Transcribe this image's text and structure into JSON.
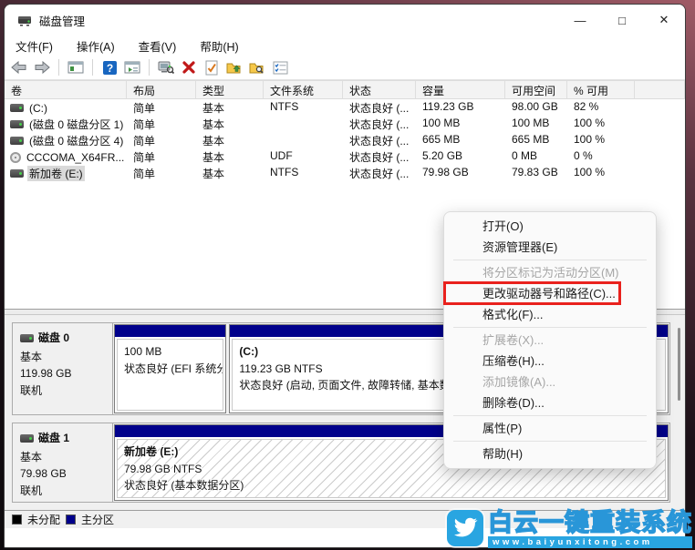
{
  "window": {
    "title": "磁盘管理",
    "controls": {
      "minimize": "—",
      "maximize": "□",
      "close": "✕"
    }
  },
  "menu_bar": {
    "file": "文件(F)",
    "action": "操作(A)",
    "view": "查看(V)",
    "help": "帮助(H)"
  },
  "toolbar": {
    "icon_names": [
      "back-arrow-icon",
      "forward-arrow-icon",
      "console-window-icon",
      "help-icon",
      "action-pane-icon",
      "computer-search-icon",
      "delete-red-x-icon",
      "check-document-icon",
      "folder-up-icon",
      "folder-search-icon",
      "checklist-icon"
    ]
  },
  "volume_table": {
    "columns": [
      "卷",
      "布局",
      "类型",
      "文件系统",
      "状态",
      "容量",
      "可用空间",
      "% 可用"
    ],
    "rows": [
      {
        "icon": "disk",
        "name": "(C:)",
        "layout": "简单",
        "type": "基本",
        "fs": "NTFS",
        "status": "状态良好 (...",
        "capacity": "119.23 GB",
        "free": "98.00 GB",
        "pct": "82 %"
      },
      {
        "icon": "disk",
        "name": "(磁盘 0 磁盘分区 1)",
        "layout": "简单",
        "type": "基本",
        "fs": "",
        "status": "状态良好 (...",
        "capacity": "100 MB",
        "free": "100 MB",
        "pct": "100 %"
      },
      {
        "icon": "disk",
        "name": "(磁盘 0 磁盘分区 4)",
        "layout": "简单",
        "type": "基本",
        "fs": "",
        "status": "状态良好 (...",
        "capacity": "665 MB",
        "free": "665 MB",
        "pct": "100 %"
      },
      {
        "icon": "cd",
        "name": "CCCOMA_X64FR...",
        "layout": "简单",
        "type": "基本",
        "fs": "UDF",
        "status": "状态良好 (...",
        "capacity": "5.20 GB",
        "free": "0 MB",
        "pct": "0 %"
      },
      {
        "icon": "disk",
        "name": "新加卷 (E:)",
        "layout": "简单",
        "type": "基本",
        "fs": "NTFS",
        "status": "状态良好 (...",
        "capacity": "79.98 GB",
        "free": "79.83 GB",
        "pct": "100 %",
        "selected": true
      }
    ]
  },
  "disks": [
    {
      "label": "磁盘 0",
      "type": "基本",
      "size": "119.98 GB",
      "status": "联机",
      "partitions": [
        {
          "name": "",
          "size_line": "100 MB",
          "status_line": "状态良好 (EFI 系统分"
        },
        {
          "name": "(C:)",
          "size_line": "119.23 GB NTFS",
          "status_line": "状态良好 (启动, 页面文件, 故障转储, 基本数"
        }
      ]
    },
    {
      "label": "磁盘 1",
      "type": "基本",
      "size": "79.98 GB",
      "status": "联机",
      "partitions": [
        {
          "name": "新加卷  (E:)",
          "size_line": "79.98 GB NTFS",
          "status_line": "状态良好 (基本数据分区)",
          "hatched": true
        }
      ]
    }
  ],
  "legend": {
    "items": [
      {
        "color": "#000000",
        "label": "未分配"
      },
      {
        "color": "#00008b",
        "label": "主分区"
      }
    ]
  },
  "context_menu": {
    "items": [
      {
        "label": "打开(O)",
        "enabled": true
      },
      {
        "label": "资源管理器(E)",
        "enabled": true
      },
      {
        "label": "将分区标记为活动分区(M)",
        "enabled": false
      },
      {
        "label": "更改驱动器号和路径(C)...",
        "enabled": true,
        "highlighted_with_red_box": true
      },
      {
        "label": "格式化(F)...",
        "enabled": true
      },
      {
        "label": "扩展卷(X)...",
        "enabled": false
      },
      {
        "label": "压缩卷(H)...",
        "enabled": true
      },
      {
        "label": "添加镜像(A)...",
        "enabled": false
      },
      {
        "label": "删除卷(D)...",
        "enabled": true
      },
      {
        "label": "属性(P)",
        "enabled": true
      },
      {
        "label": "帮助(H)",
        "enabled": true
      }
    ]
  },
  "watermark": {
    "title": "白云一键重装系统",
    "url": "www.baiyunxitong.com",
    "color": "#29a5e1"
  },
  "colors": {
    "partition_band_navy": "#00008b",
    "annotation_red": "#e9211d",
    "unallocated_black": "#000000",
    "watermark_blue": "#29a5e1"
  }
}
